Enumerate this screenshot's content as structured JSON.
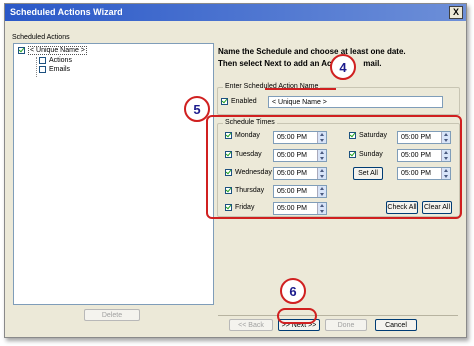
{
  "window": {
    "title": "Scheduled Actions Wizard",
    "close_label": "X"
  },
  "left_panel": {
    "label": "Scheduled Actions",
    "tree": [
      {
        "label": "< Unique Name >",
        "checked": true,
        "level": 0
      },
      {
        "label": "Actions",
        "checked": false,
        "level": 1
      },
      {
        "label": "Emails",
        "checked": false,
        "level": 1
      }
    ],
    "delete_label": "Delete"
  },
  "instructions": {
    "line1": "Name the Schedule and choose at least one date.",
    "line2": "Then select Next to add an Actio",
    "line2_tail": "mail."
  },
  "action_name": {
    "group_label": "Enter Scheduled Action Name",
    "enabled_label": "Enabled",
    "enabled": true,
    "name_value": "< Unique Name >"
  },
  "schedule": {
    "group_label": "Schedule Times",
    "days": [
      {
        "label": "Monday",
        "checked": true,
        "time": "05:00 PM"
      },
      {
        "label": "Tuesday",
        "checked": true,
        "time": "05:00 PM"
      },
      {
        "label": "Wednesday",
        "checked": true,
        "time": "05:00 PM"
      },
      {
        "label": "Thursday",
        "checked": true,
        "time": "05:00 PM"
      },
      {
        "label": "Friday",
        "checked": true,
        "time": "05:00 PM"
      },
      {
        "label": "Saturday",
        "checked": true,
        "time": "05:00 PM"
      },
      {
        "label": "Sunday",
        "checked": true,
        "time": "05:00 PM"
      }
    ],
    "set_all_label": "Set All",
    "set_all_time": "05:00 PM",
    "check_all_label": "Check All",
    "clear_all_label": "Clear All"
  },
  "buttons": {
    "back": "<< Back",
    "next": ">> Next >>",
    "done": "Done",
    "cancel": "Cancel"
  },
  "callouts": {
    "c4": "4",
    "c5": "5",
    "c6": "6"
  },
  "colors": {
    "highlight": "#d02020",
    "titlebar": "#2a58c8",
    "callout_text": "#1b1b8c"
  }
}
